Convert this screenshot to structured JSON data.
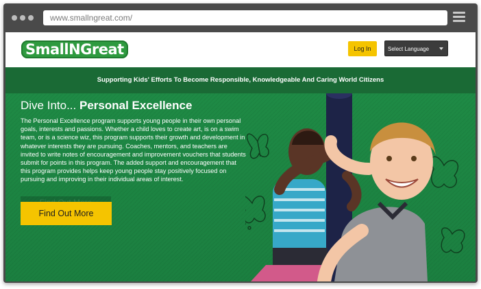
{
  "browser": {
    "url": "www.smallngreat.com/",
    "menu_icon": "hamburger-menu-icon"
  },
  "header": {
    "logo_text": "SmallNGreat",
    "login_label": "Log In",
    "language_select": {
      "selected": "Select Language",
      "icon": "caret-down-icon"
    }
  },
  "tagline": "Supporting Kids' Efforts To Become Responsible, Knowledgeable And Caring World Citizens",
  "hero": {
    "title_prefix": "Dive Into...",
    "title_emphasis": "Personal Excellence",
    "body": "The Personal Excellence program supports young people in their own personal goals, interests and passions.  Whether a child loves to create art, is on a swim team, or is a science wiz, this program supports their growth and development in whatever interests they are pursuing.  Coaches, mentors, and teachers are invited to write notes of encouragement and improvement vouchers that students submit for points in this program.  The added support and encouragement that this program provides helps keep young people stay positively focused on pursuing and improving in their individual areas of interest.",
    "ghost_button_label": "Find Out More",
    "cta_label": "Find Out More",
    "decoration_icons": [
      "butterfly-icon",
      "butterfly-icon",
      "butterfly-icon",
      "butterfly-icon"
    ]
  },
  "colors": {
    "brand_green": "#1b7f40",
    "tagbar_green": "#1a6a35",
    "accent_yellow": "#f5c400",
    "frame_gray": "#4a4a4a"
  }
}
